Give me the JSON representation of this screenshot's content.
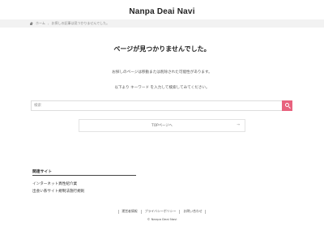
{
  "header": {
    "site_title": "Nanpa Deai Navi"
  },
  "breadcrumb": {
    "home_label": "ホーム",
    "current": "お探しの記事は見つかりませんでした。"
  },
  "main": {
    "heading": "ページが見つかりませんでした。",
    "message_1": "お探しのページは移動または削除された可能性があります。",
    "message_2": "以下より キーワード を入力して検索してみてください。",
    "search": {
      "placeholder": "検索",
      "button_icon": "search-icon"
    },
    "top_link": {
      "label": "TOPページへ",
      "arrow": "→"
    }
  },
  "related": {
    "title": "関連サイト",
    "items": [
      "インターネット異性紹介業",
      "出会い系サイト規制法施行規則"
    ]
  },
  "footer": {
    "links": [
      "運営者情報",
      "プライバシーポリシー",
      "お問い合わせ"
    ],
    "copyright": "© Nanpa Deai Navi"
  },
  "colors": {
    "accent": "#e8627e",
    "breadcrumb_bg": "#f2f2f2"
  }
}
